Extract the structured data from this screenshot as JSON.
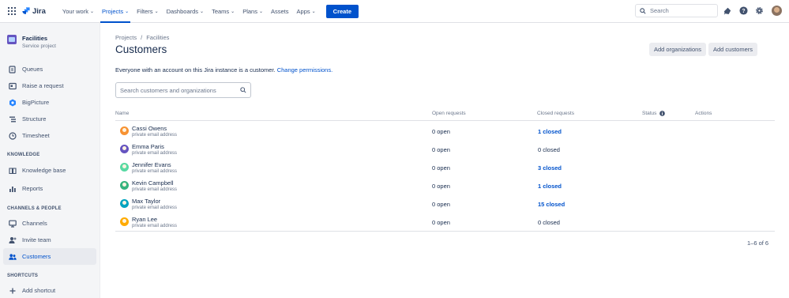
{
  "nav": {
    "logo_text": "Jira",
    "items": [
      {
        "label": "Your work",
        "active": false
      },
      {
        "label": "Projects",
        "active": true
      },
      {
        "label": "Filters",
        "active": false
      },
      {
        "label": "Dashboards",
        "active": false
      },
      {
        "label": "Teams",
        "active": false
      },
      {
        "label": "Plans",
        "active": false
      },
      {
        "label": "Assets",
        "active": false,
        "no_chevron": true
      },
      {
        "label": "Apps",
        "active": false
      }
    ],
    "create_label": "Create",
    "search_placeholder": "Search",
    "brand_color": "#0052cc"
  },
  "sidebar": {
    "project_name": "Facilities",
    "project_type": "Service project",
    "items_top": [
      {
        "label": "Queues",
        "icon": "queues-icon"
      },
      {
        "label": "Raise a request",
        "icon": "raise-request-icon"
      },
      {
        "label": "BigPicture",
        "icon": "bigpicture-icon"
      },
      {
        "label": "Structure",
        "icon": "structure-icon"
      },
      {
        "label": "Timesheet",
        "icon": "timesheet-icon"
      }
    ],
    "knowledge_heading": "KNOWLEDGE",
    "items_knowledge": [
      {
        "label": "Knowledge base",
        "icon": "knowledge-base-icon"
      },
      {
        "label": "Reports",
        "icon": "reports-icon"
      }
    ],
    "channels_heading": "CHANNELS & PEOPLE",
    "items_channels": [
      {
        "label": "Channels",
        "icon": "channels-icon"
      },
      {
        "label": "Invite team",
        "icon": "invite-team-icon"
      },
      {
        "label": "Customers",
        "icon": "customers-icon",
        "active": true
      }
    ],
    "shortcuts_heading": "SHORTCUTS",
    "add_shortcut_label": "Add shortcut"
  },
  "main": {
    "breadcrumb": [
      "Projects",
      "/",
      "Facilities"
    ],
    "title": "Customers",
    "add_organizations_label": "Add organizations",
    "add_customers_label": "Add customers",
    "notice_text": "Everyone with an account on this Jira instance is a customer.",
    "notice_link": "Change permissions.",
    "search_placeholder": "Search customers and organizations",
    "columns": {
      "name": "Name",
      "open": "Open requests",
      "closed": "Closed requests",
      "status": "Status",
      "actions": "Actions"
    },
    "customers": [
      {
        "name": "Cassi Owens",
        "email": "private email address",
        "open": "0 open",
        "closed": "1 closed",
        "closed_link": true,
        "avatar_color": "#f79232"
      },
      {
        "name": "Emma Paris",
        "email": "private email address",
        "open": "0 open",
        "closed": "0 closed",
        "closed_link": false,
        "avatar_color": "#6554c0"
      },
      {
        "name": "Jennifer Evans",
        "email": "private email address",
        "open": "0 open",
        "closed": "3 closed",
        "closed_link": true,
        "avatar_color": "#57d9a3"
      },
      {
        "name": "Kevin Campbell",
        "email": "private email address",
        "open": "0 open",
        "closed": "1 closed",
        "closed_link": true,
        "avatar_color": "#36b37e"
      },
      {
        "name": "Max Taylor",
        "email": "private email address",
        "open": "0 open",
        "closed": "15 closed",
        "closed_link": true,
        "avatar_color": "#00a3bf"
      },
      {
        "name": "Ryan Lee",
        "email": "private email address",
        "open": "0 open",
        "closed": "0 closed",
        "closed_link": false,
        "avatar_color": "#ffab00"
      }
    ],
    "pagination": "1–6 of 6"
  }
}
